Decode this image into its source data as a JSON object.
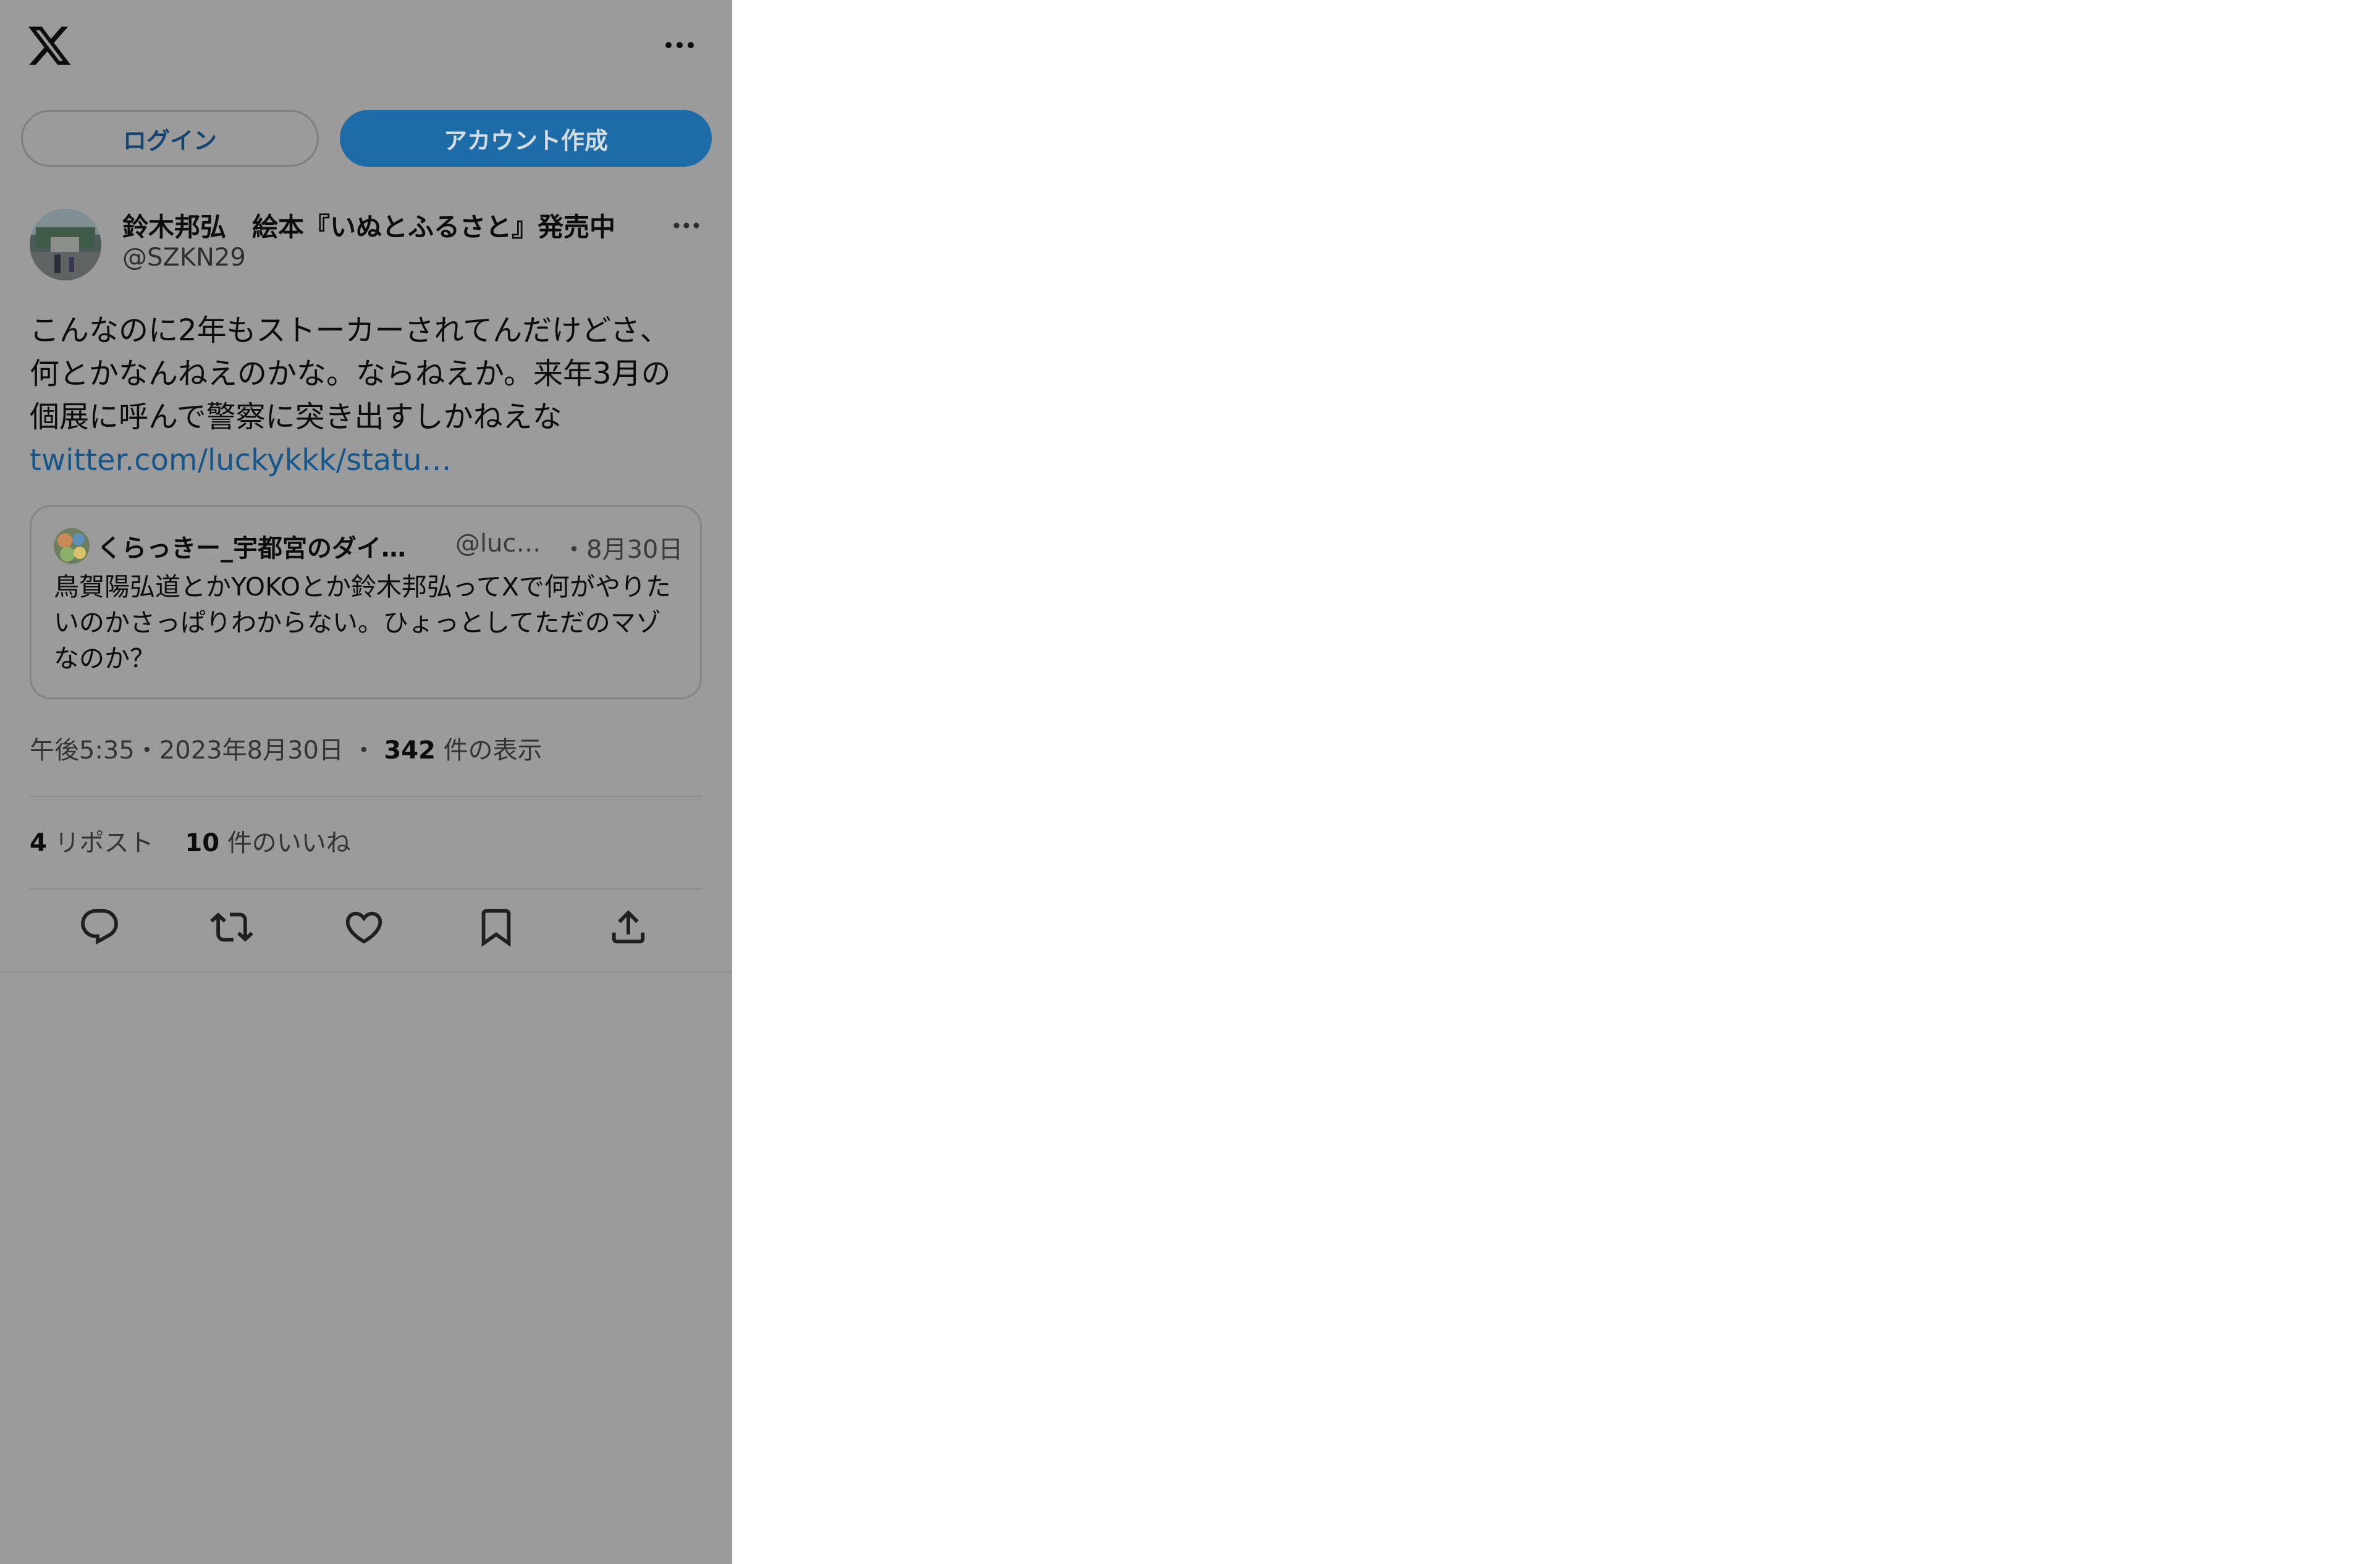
{
  "top_bar": {
    "logo_icon": "x-logo-icon",
    "more_icon": "more-horizontal-icon"
  },
  "buttons": {
    "login": "ログイン",
    "signup": "アカウント作成"
  },
  "tweet": {
    "author_name": "鈴木邦弘　絵本『いぬとふるさと』発売中",
    "author_handle": "@SZKN29",
    "text_lines": [
      "こんなのに2年もストーカーされてんだけどさ、",
      "何とかなんねえのかな。ならねえか。来年3月の",
      "個展に呼んで警察に突き出すしかねえな"
    ],
    "link_text": "twitter.com/luckykkk/statu…",
    "quote": {
      "name": "くらっきー_宇都宮のダイ…",
      "handle": "@luc…",
      "date": "・8月30日",
      "text": "鳥賀陽弘道とかYOKOとか鈴木邦弘ってXで何がやりたいのかさっぱりわからない。ひょっとしてただのマゾなのか？"
    },
    "meta": {
      "time": "午後5:35",
      "sep1": "・",
      "date": "2023年8月30日",
      "sep2": "・",
      "views": "342",
      "views_label": "件の表示"
    },
    "stats": {
      "reposts": "4",
      "reposts_label": "リポスト",
      "likes": "10",
      "likes_label": "件のいいね"
    },
    "actions": [
      "reply-icon",
      "repost-icon",
      "like-icon",
      "bookmark-icon",
      "share-icon"
    ]
  },
  "colors": {
    "overlay_bg": "#9b9b9b",
    "accent": "#1d6ca8",
    "link": "#17568b",
    "text": "#0c0c0c"
  }
}
